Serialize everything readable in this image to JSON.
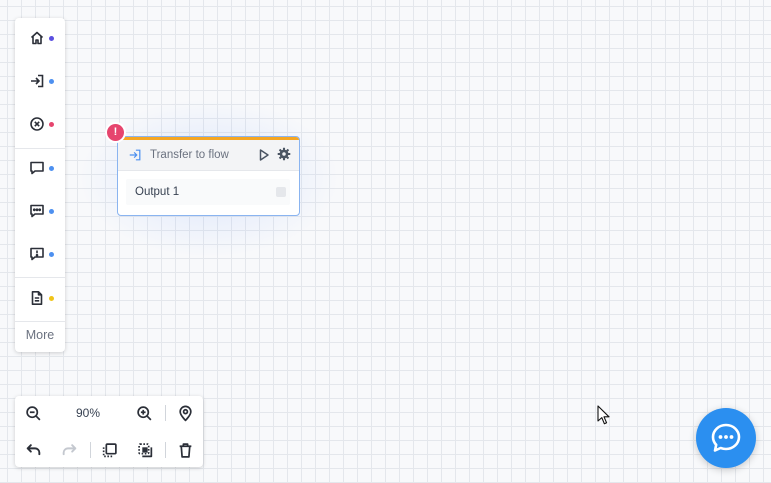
{
  "palette": {
    "items": [
      {
        "icon": "home-icon",
        "dot_color": "#5b4fe0"
      },
      {
        "icon": "enter-flow-icon",
        "dot_color": "#4d90f0"
      },
      {
        "icon": "close-circle-icon",
        "dot_color": "#e6456e"
      },
      {
        "icon": "message-icon",
        "dot_color": "#4d90f0"
      },
      {
        "icon": "message-dots-icon",
        "dot_color": "#4d90f0"
      },
      {
        "icon": "message-alert-icon",
        "dot_color": "#4d90f0"
      },
      {
        "icon": "document-icon",
        "dot_color": "#f0c419"
      }
    ],
    "more_label": "More"
  },
  "node": {
    "title": "Transfer to flow",
    "error_badge": "!",
    "type_icon": "transfer-icon",
    "accent_color": "#f5a623",
    "outputs": [
      {
        "label": "Output 1"
      }
    ]
  },
  "toolbar": {
    "zoom_level": "90%"
  },
  "chat": {
    "icon": "chat-icon",
    "color": "#2b8ff0"
  }
}
